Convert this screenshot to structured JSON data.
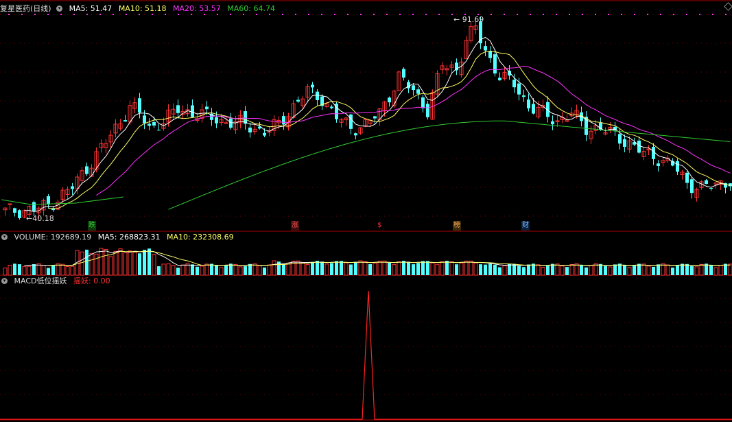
{
  "window": {
    "stock_name": "复星医药(日线)",
    "ma": [
      {
        "label": "MA5: 51.47",
        "color": "#ffffff"
      },
      {
        "label": "MA10: 51.18",
        "color": "#ffff66"
      },
      {
        "label": "MA20: 53.57",
        "color": "#ff33ff"
      },
      {
        "label": "MA60: 64.74",
        "color": "#33cc33"
      }
    ]
  },
  "price_panel": {
    "high_label": "91.69",
    "low_label": "40.18",
    "events": [
      {
        "text": "跌",
        "color": "#33cc33",
        "bg": "#114411"
      },
      {
        "text": "涨",
        "color": "#ff5555",
        "bg": "#441111"
      },
      {
        "text": "$",
        "color": "#ff3333",
        "bg": "#000000"
      },
      {
        "text": "榜",
        "color": "#ffaa55",
        "bg": "#443311"
      },
      {
        "text": "财",
        "color": "#55aaff",
        "bg": "#112244"
      }
    ]
  },
  "volume_panel": {
    "label": "VOLUME: 192689.19",
    "ma5": "MA5: 268823.31",
    "ma10": "MA10: 232308.69"
  },
  "macd_panel": {
    "label": "MACD低位摇妖",
    "value": "摇妖: 0.00"
  },
  "colors": {
    "up": "#ff3333",
    "down": "#54ffff",
    "grid": "#7a0000",
    "ma5": "#ffffff",
    "ma10": "#ffff66",
    "ma20": "#ff33ff",
    "ma60": "#33cc33",
    "vol_ma5": "#ffffff",
    "vol_ma10": "#ffff66",
    "macd": "#ff2222"
  }
}
